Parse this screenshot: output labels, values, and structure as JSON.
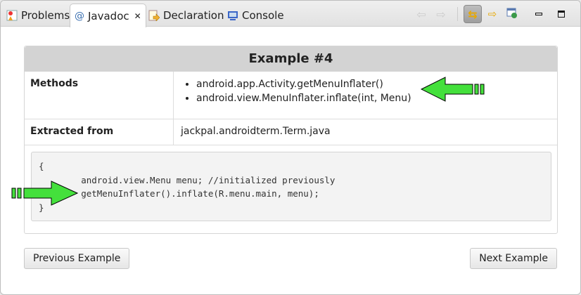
{
  "tabs": [
    {
      "label": "Problems",
      "icon": "problems-icon"
    },
    {
      "label": "Javadoc",
      "icon": "at-icon",
      "active": true
    },
    {
      "label": "Declaration",
      "icon": "declaration-icon"
    },
    {
      "label": "Console",
      "icon": "console-icon"
    }
  ],
  "javadoc_symbol": "@",
  "title": "Example #4",
  "methods_label": "Methods",
  "methods": [
    "android.app.Activity.getMenuInflater()",
    "android.view.MenuInflater.inflate(int, Menu)"
  ],
  "extracted_label": "Extracted from",
  "extracted_value": "jackpal.androidterm.Term.java",
  "code": "{\n        android.view.Menu menu; //initialized previously\n        getMenuInflater().inflate(R.menu.main, menu);\n}",
  "prev_button": "Previous Example",
  "next_button": "Next Example",
  "colors": {
    "arrow": "#44e03c",
    "header": "#d3d3d3"
  }
}
